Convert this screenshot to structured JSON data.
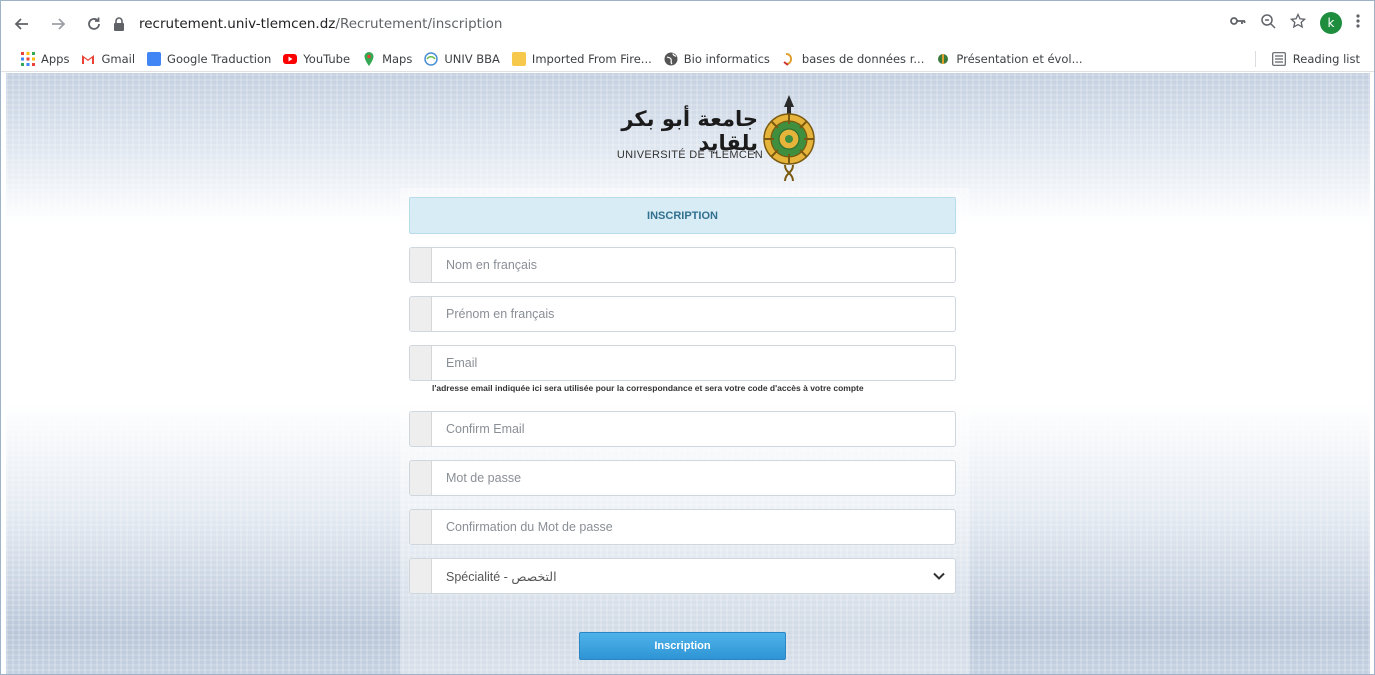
{
  "browser": {
    "url_host": "recrutement.univ-tlemcen.dz",
    "url_path": "/Recrutement/inscription",
    "profile_initial": "k",
    "bookmarks": [
      {
        "label": "Apps",
        "icon": "apps-grid-icon",
        "color": "#ea4335"
      },
      {
        "label": "Gmail",
        "icon": "gmail-icon",
        "color": "#ea4335"
      },
      {
        "label": "Google Traduction",
        "icon": "google-translate-icon",
        "color": "#4285f4"
      },
      {
        "label": "YouTube",
        "icon": "youtube-icon",
        "color": "#ff0000"
      },
      {
        "label": "Maps",
        "icon": "maps-icon",
        "color": "#34a853"
      },
      {
        "label": "UNIV BBA",
        "icon": "univ-bba-icon",
        "color": "#4a8fd6"
      },
      {
        "label": "Imported From Fire...",
        "icon": "folder-icon",
        "color": "#f6c94c"
      },
      {
        "label": "Bio informatics",
        "icon": "globe-icon",
        "color": "#555555"
      },
      {
        "label": "bases de données r...",
        "icon": "site-icon",
        "color": "#e0a030"
      },
      {
        "label": "Présentation et évol...",
        "icon": "site-icon",
        "color": "#3a7a3a"
      }
    ],
    "reading_list": "Reading list"
  },
  "logo": {
    "arabic": "جامعة أبو بكر بلقايد",
    "french": "UNIVERSITÉ DE TLEMCEN"
  },
  "form": {
    "header": "INSCRIPTION",
    "nom_placeholder": "Nom en français",
    "prenom_placeholder": "Prénom en français",
    "email_placeholder": "Email",
    "email_help": "l'adresse email indiquée ici sera utilisée pour la correspondance et sera votre code d'accès à votre compte",
    "confirm_email_placeholder": "Confirm Email",
    "password_placeholder": "Mot de passe",
    "confirm_password_placeholder": "Confirmation du Mot de passe",
    "specialite_selected": "Spécialité - التخصص",
    "submit_label": "Inscription"
  },
  "colors": {
    "header_bg": "#d8ecf5",
    "header_text": "#31708f",
    "button": "#2f94d5"
  }
}
